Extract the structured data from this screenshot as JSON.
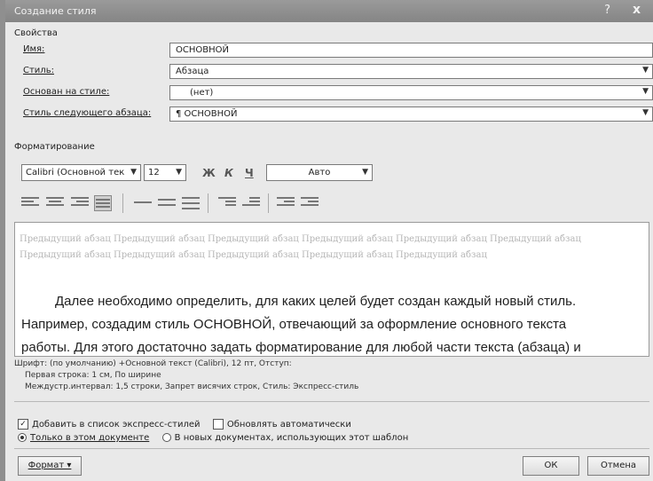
{
  "title": "Создание стиля",
  "titlebar": {
    "help": "?",
    "close": "x"
  },
  "properties": {
    "section": "Свойства",
    "name_label": "Имя:",
    "name_value": "ОСНОВНОЙ",
    "style_type_label": "Стиль:",
    "style_type_value": "Абзаца",
    "based_on_label": "Основан на стиле:",
    "based_on_value": "(нет)",
    "next_label": "Стиль следующего абзаца:",
    "next_value": "¶ ОСНОВНОЙ"
  },
  "formatting": {
    "section": "Форматирование",
    "font": "Calibri (Основной тек",
    "size": "12",
    "bold": "Ж",
    "italic": "К",
    "underline": "Ч",
    "color": "Авто"
  },
  "preview": {
    "previous_paragraph": "Предыдущий абзац Предыдущий абзац Предыдущий абзац Предыдущий абзац Предыдущий абзац Предыдущий абзац Предыдущий абзац Предыдущий абзац Предыдущий абзац Предыдущий абзац Предыдущий абзац",
    "line1": "Далее необходимо определить, для каких целей будет создан каждый новый стиль.",
    "line2": "Например, создадим стиль ОСНОВНОЙ, отвечающий за оформление основного текста",
    "line3": "работы. Для этого достаточно задать форматирование для любой части текста (абзаца) и"
  },
  "description": {
    "line1": "Шрифт: (по умолчанию) +Основной текст (Calibri), 12 пт, Отступ:",
    "line2": "Первая строка: 1 см, По ширине",
    "line3": "Междустр.интервал: 1,5 строки, Запрет висячих строк, Стиль: Экспресс-стиль"
  },
  "options": {
    "add_quick_styles": "Добавить в список экспресс-стилей",
    "auto_update": "Обновлять автоматически",
    "only_this_doc": "Только в этом документе",
    "new_docs": "В новых документах, использующих этот шаблон"
  },
  "buttons": {
    "format": "Формат ▾",
    "ok": "ОК",
    "cancel": "Отмена"
  }
}
